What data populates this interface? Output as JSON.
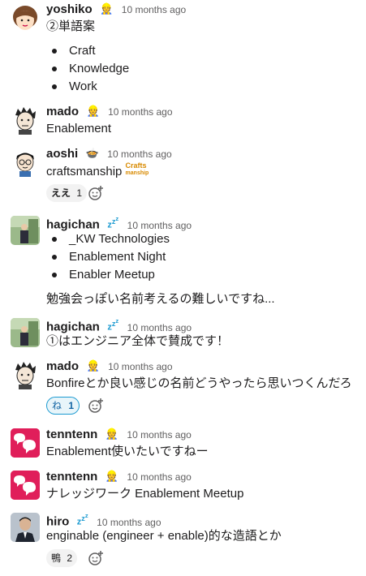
{
  "messages": [
    {
      "user": "yoshiko",
      "status_icon": "construction-worker-icon",
      "time": "10 months ago",
      "text": "②単語案",
      "bullets": [
        "Craft",
        "Knowledge",
        "Work"
      ]
    },
    {
      "user": "mado",
      "status_icon": "construction-worker-icon",
      "time": "10 months ago",
      "text": "Enablement"
    },
    {
      "user": "aoshi",
      "status_icon": "bowl-icon",
      "time": "10 months ago",
      "text": "craftsmanship",
      "custom_emoji": [
        "Crafts",
        "manship"
      ],
      "reactions": [
        {
          "emoji": "ええ",
          "count": "1"
        }
      ]
    },
    {
      "user": "hagichan",
      "status_icon": "zzz-icon",
      "time": "10 months ago",
      "bullets": [
        "_KW Technologies",
        "Enablement Night",
        "Enabler Meetup"
      ],
      "text2": "勉強会っぽい名前考えるの難しいですね..."
    },
    {
      "user": "hagichan",
      "status_icon": "zzz-icon",
      "time": "10 months ago",
      "text": "①はエンジニア全体で賛成です！"
    },
    {
      "user": "mado",
      "status_icon": "construction-worker-icon",
      "time": "10 months ago",
      "text": "Bonfireとか良い感じの名前どうやったら思いつくんだろ",
      "reactions": [
        {
          "emoji": "ね",
          "count": "1"
        }
      ]
    },
    {
      "user": "tenntenn",
      "status_icon": "construction-worker-icon",
      "time": "10 months ago",
      "text": "Enablement使いたいですねー"
    },
    {
      "user": "tenntenn",
      "status_icon": "construction-worker-icon",
      "time": "10 months ago",
      "text": "ナレッジワーク Enablement Meetup"
    },
    {
      "user": "hiro",
      "status_icon": "zzz-icon",
      "time": "10 months ago",
      "text": "enginable (engineer + enable)的な造語とか",
      "reactions": [
        {
          "emoji": "鴨",
          "count": "2"
        }
      ]
    }
  ],
  "colors": {
    "tenntenn_avatar": "#e01e5a",
    "link_blue": "#1264a3",
    "zzz_blue": "#1d9bd1"
  }
}
